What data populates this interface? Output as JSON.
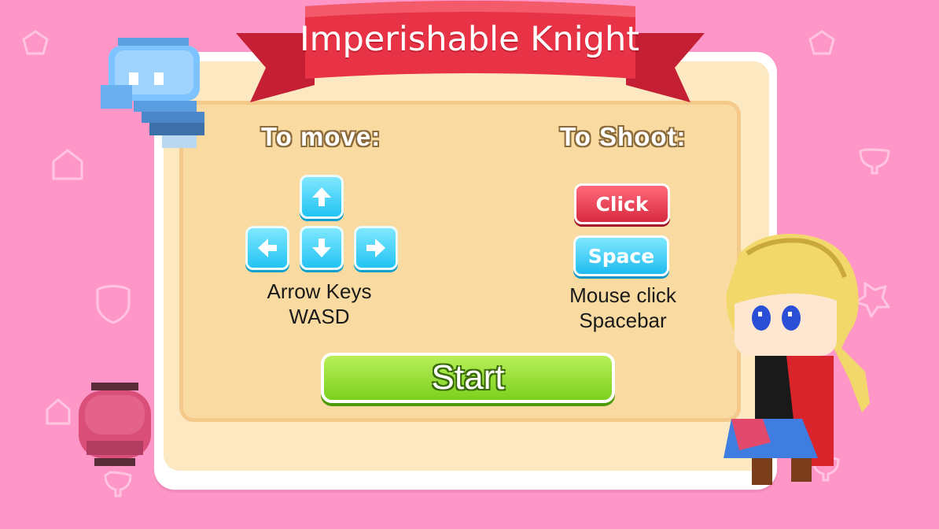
{
  "title": "Imperishable Knight",
  "move": {
    "heading": "To move:",
    "keys": [
      "up-arrow-icon",
      "left-arrow-icon",
      "down-arrow-icon",
      "right-arrow-icon"
    ],
    "caption_line1": "Arrow Keys",
    "caption_line2": "WASD"
  },
  "shoot": {
    "heading": "To Shoot:",
    "click_label": "Click",
    "space_label": "Space",
    "caption_line1": "Mouse click",
    "caption_line2": "Spacebar"
  },
  "start_label": "Start",
  "colors": {
    "background": "#ff96c8",
    "ribbon": "#e83347",
    "panel": "#f9dba1",
    "start": "#8fdc2a",
    "key_blue": "#2ec8f5",
    "click_red": "#e03246"
  }
}
